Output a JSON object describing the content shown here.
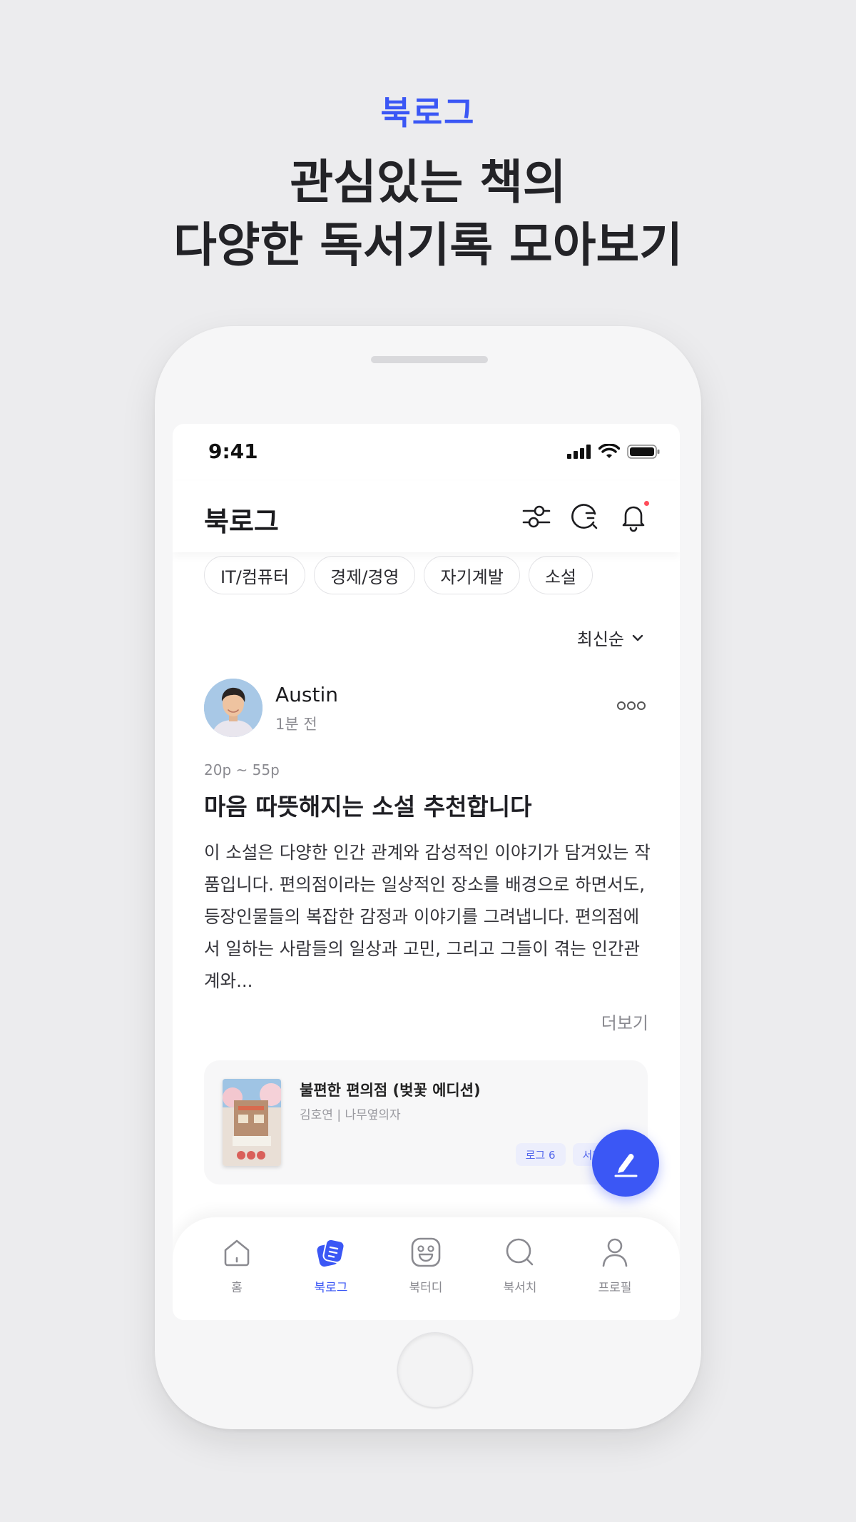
{
  "promo": {
    "label": "북로그",
    "headline_line1": "관심있는 책의",
    "headline_line2": "다양한 독서기록 모아보기"
  },
  "status_bar": {
    "time": "9:41"
  },
  "header": {
    "title": "북로그"
  },
  "categories": [
    "IT/컴퓨터",
    "경제/경영",
    "자기계발",
    "소설"
  ],
  "sort": {
    "label": "최신순"
  },
  "post": {
    "author": "Austin",
    "time": "1분 전",
    "page_range": "20p ~ 55p",
    "title": "마음 따뜻해지는 소설 추천합니다",
    "body": "이 소설은 다양한 인간 관계와 감성적인 이야기가 담겨있는 작품입니다. 편의점이라는 일상적인 장소를 배경으로 하면서도, 등장인물들의 복잡한 감정과 이야기를 그려냅니다. 편의점에서 일하는 사람들의 일상과 고민, 그리고 그들이 겪는 인간관계와...",
    "more": "더보기"
  },
  "book": {
    "title": "불편한 편의점 (벚꽃 에디션)",
    "meta": "김호연 | 나무옆의자",
    "tags": [
      "로그 6",
      "서재 20"
    ]
  },
  "nav": [
    {
      "label": "홈",
      "icon": "home-icon"
    },
    {
      "label": "북로그",
      "icon": "booklog-icon"
    },
    {
      "label": "북터디",
      "icon": "smile-icon"
    },
    {
      "label": "북서치",
      "icon": "search-icon"
    },
    {
      "label": "프로필",
      "icon": "profile-icon"
    }
  ],
  "colors": {
    "accent": "#3b57f5",
    "background": "#ececee"
  }
}
